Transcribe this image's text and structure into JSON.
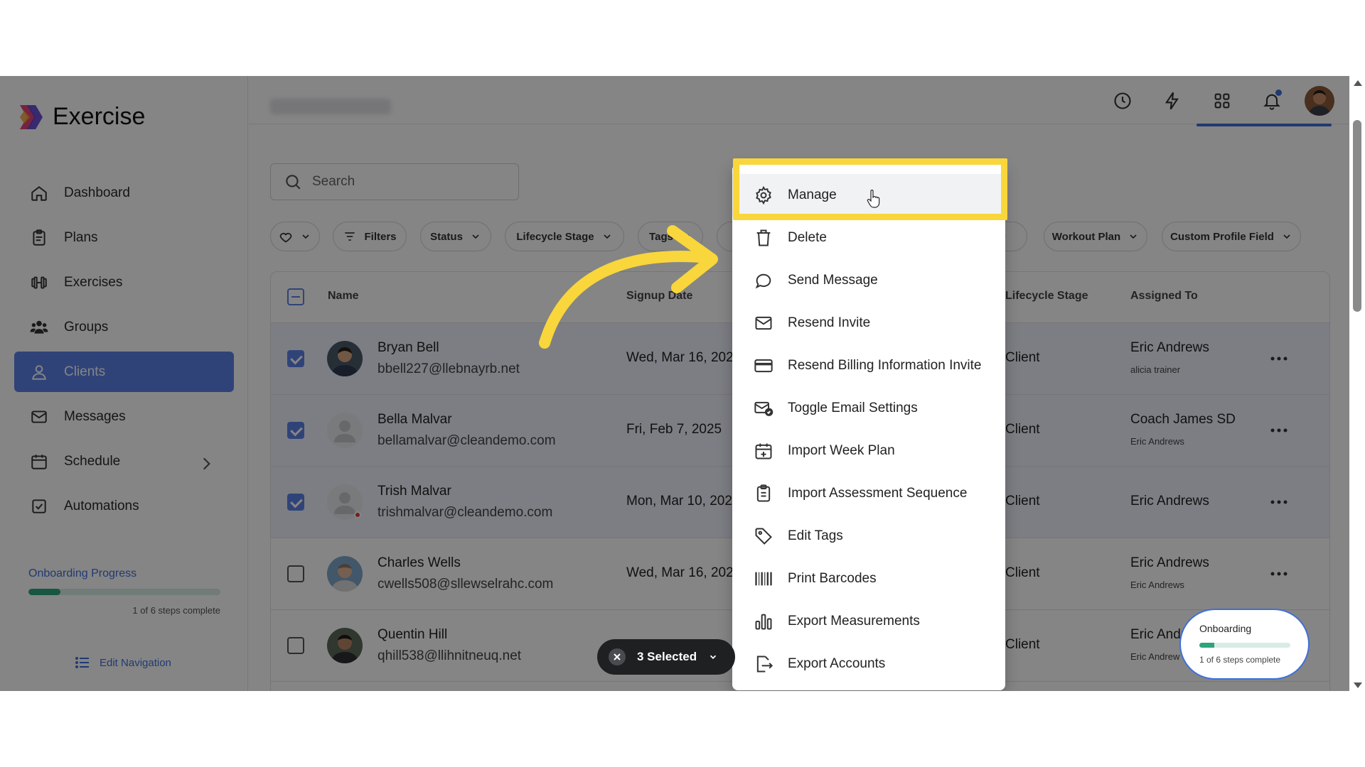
{
  "app": {
    "name": "Exercise"
  },
  "sidebar": {
    "items": [
      {
        "label": "Dashboard",
        "icon": "home-icon"
      },
      {
        "label": "Plans",
        "icon": "clipboard-icon"
      },
      {
        "label": "Exercises",
        "icon": "dumbbell-icon"
      },
      {
        "label": "Groups",
        "icon": "users-icon"
      },
      {
        "label": "Clients",
        "icon": "user-icon",
        "active": true
      },
      {
        "label": "Messages",
        "icon": "mail-icon"
      },
      {
        "label": "Schedule",
        "icon": "calendar-icon",
        "has_chevron": true
      },
      {
        "label": "Automations",
        "icon": "checkbox-icon"
      }
    ],
    "onboarding": {
      "title": "Onboarding Progress",
      "steps": "1 of 6 steps complete",
      "progress": 0.167
    },
    "edit_nav": "Edit Navigation"
  },
  "search": {
    "placeholder": "Search"
  },
  "filters": {
    "filters_label": "Filters",
    "status_label": "Status",
    "lifecycle_label": "Lifecycle Stage",
    "tags_label": "Tags",
    "workout_plan_label": "Workout Plan",
    "custom_field_label": "Custom Profile Field"
  },
  "table": {
    "headers": {
      "name": "Name",
      "signup": "Signup Date",
      "lifecycle": "Lifecycle Stage",
      "assigned": "Assigned To"
    },
    "rows": [
      {
        "name": "Bryan Bell",
        "email": "bbell227@llebnayrb.net",
        "date": "Wed, Mar 16, 202",
        "stage": "Client",
        "assigned": "Eric Andrews",
        "assigned2": "alicia trainer",
        "selected": true
      },
      {
        "name": "Bella Malvar",
        "email": "bellamalvar@cleandemo.com",
        "date": "Fri, Feb 7, 2025",
        "stage": "Client",
        "assigned": "Coach James SD",
        "assigned2": "Eric Andrews",
        "selected": true
      },
      {
        "name": "Trish Malvar",
        "email": "trishmalvar@cleandemo.com",
        "date": "Mon, Mar 10, 202",
        "stage": "Client",
        "assigned": "Eric Andrews",
        "assigned2": "",
        "selected": true
      },
      {
        "name": "Charles Wells",
        "email": "cwells508@sllewselrahc.com",
        "date": "Wed, Mar 16, 202",
        "stage": "Client",
        "assigned": "Eric Andrews",
        "assigned2": "Eric Andrews",
        "selected": false
      },
      {
        "name": "Quentin Hill",
        "email": "qhill538@llihnitneuq.net",
        "date": "",
        "stage": "Client",
        "assigned": "Eric Andr",
        "assigned2": "Eric Andrew",
        "selected": false
      }
    ]
  },
  "menu": {
    "items": [
      {
        "label": "Manage",
        "icon": "gear-icon"
      },
      {
        "label": "Delete",
        "icon": "trash-icon"
      },
      {
        "label": "Send Message",
        "icon": "chat-bubble-icon"
      },
      {
        "label": "Resend Invite",
        "icon": "mail-icon"
      },
      {
        "label": "Resend Billing Information Invite",
        "icon": "credit-card-icon"
      },
      {
        "label": "Toggle Email Settings",
        "icon": "mail-check-icon"
      },
      {
        "label": "Import Week Plan",
        "icon": "calendar-plus-icon"
      },
      {
        "label": "Import Assessment Sequence",
        "icon": "clipboard-list-icon"
      },
      {
        "label": "Edit Tags",
        "icon": "tag-icon"
      },
      {
        "label": "Print Barcodes",
        "icon": "barcode-icon"
      },
      {
        "label": "Export Measurements",
        "icon": "bar-chart-icon"
      },
      {
        "label": "Export Accounts",
        "icon": "file-export-icon"
      }
    ]
  },
  "selection": {
    "label": "3 Selected"
  },
  "onboarding_widget": {
    "title": "Onboarding",
    "steps": "1 of 6 steps complete",
    "progress": 0.167
  },
  "colors": {
    "accent": "#5d80e8",
    "highlight": "#f9d63b",
    "progress": "#2ca57c",
    "link": "#3f6fd8"
  }
}
